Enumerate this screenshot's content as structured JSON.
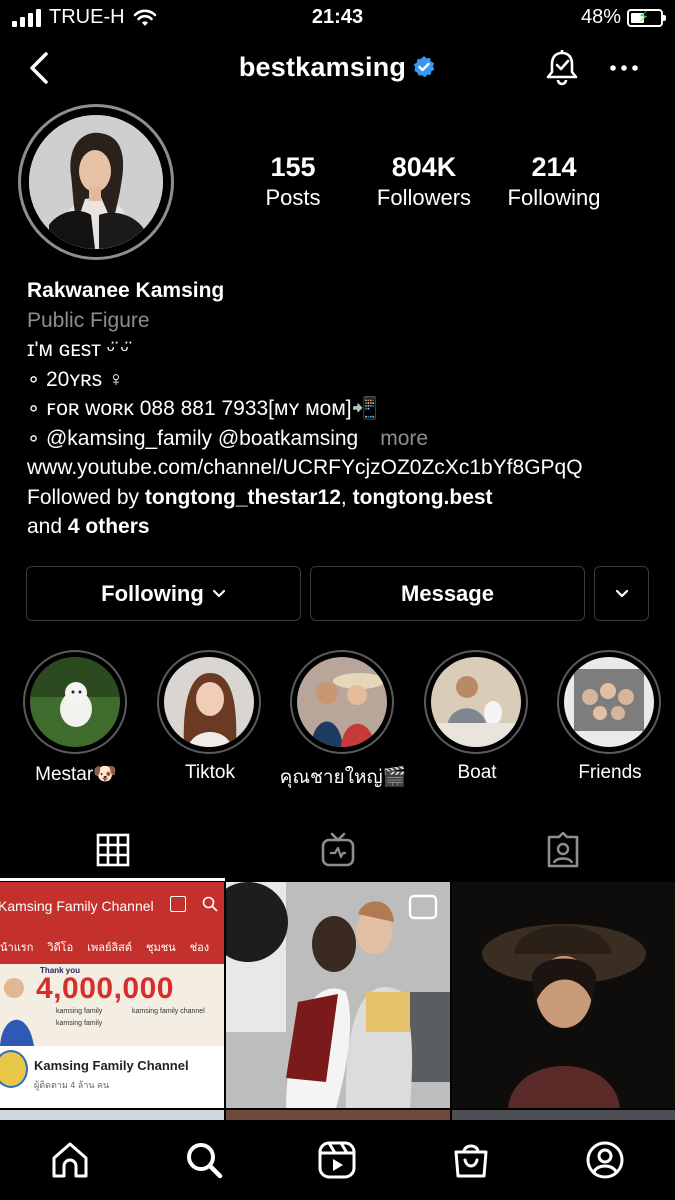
{
  "status_bar": {
    "carrier": "TRUE-H",
    "time": "21:43",
    "battery_percent": "48%",
    "battery_level": 0.48
  },
  "header": {
    "username": "bestkamsing",
    "verified": true,
    "icons": [
      "back-icon",
      "notification-bell-icon",
      "more-options-icon"
    ]
  },
  "profile": {
    "stats": [
      {
        "value": "155",
        "label": "Posts"
      },
      {
        "value": "804K",
        "label": "Followers"
      },
      {
        "value": "214",
        "label": "Following"
      }
    ],
    "name": "Rakwanee Kamsing",
    "category": "Public Figure",
    "bio_lines": [
      "ɪ'ᴍ ɢᴇѕᴛ ᵕ̈ ᵕ̈",
      "∘ 20ʏʀѕ ♀",
      "∘ ꜰᴏʀ ᴡᴏʀᴋ 088 881 7933[ᴍʏ ᴍᴏᴍ]📲",
      "∘ @kamsing_family @boatkamsing"
    ],
    "more_label": "more",
    "website": "www.youtube.com/channel/UCRFYcjzOZ0ZcXc1bYf8GPqQ",
    "followed_by_prefix": "Followed by ",
    "followed_by_user1": "tongtong_thestar12",
    "followed_by_sep": ", ",
    "followed_by_user2": "tongtong.best",
    "followed_by_and": "and ",
    "followed_by_others": "4 others"
  },
  "actions": {
    "following_label": "Following",
    "message_label": "Message"
  },
  "highlights": [
    {
      "label": "Mestar🐶"
    },
    {
      "label": "Tiktok"
    },
    {
      "label": "คุณชายใหญ่🎬"
    },
    {
      "label": "Boat"
    },
    {
      "label": "Friends"
    }
  ],
  "tabs": [
    "grid-icon",
    "igtv-icon",
    "tagged-icon"
  ],
  "posts": {
    "first": {
      "channel_bar_title": "Kamsing Family Channel",
      "nav_items": [
        "น้าแรก",
        "วิดีโอ",
        "เพลย์ลิสต์",
        "ชุมชน",
        "ช่อง"
      ],
      "thanks": "Thank you",
      "milestone": "4,000,000",
      "tags": [
        "kamsing family",
        "kamsing family",
        "kamsing family channel"
      ],
      "channel_name": "Kamsing Family Channel",
      "subscribers": "ผู้ติดตาม 4 ล้าน คน"
    }
  },
  "bottom_nav": [
    "home-icon",
    "search-icon",
    "reels-icon",
    "shop-icon",
    "profile-icon"
  ],
  "colors": {
    "background": "#000000",
    "secondary_text": "#8e8e8e",
    "verified_blue": "#3897f0",
    "button_border": "#3a3a3a",
    "battery_bolt": "#32d74b"
  }
}
